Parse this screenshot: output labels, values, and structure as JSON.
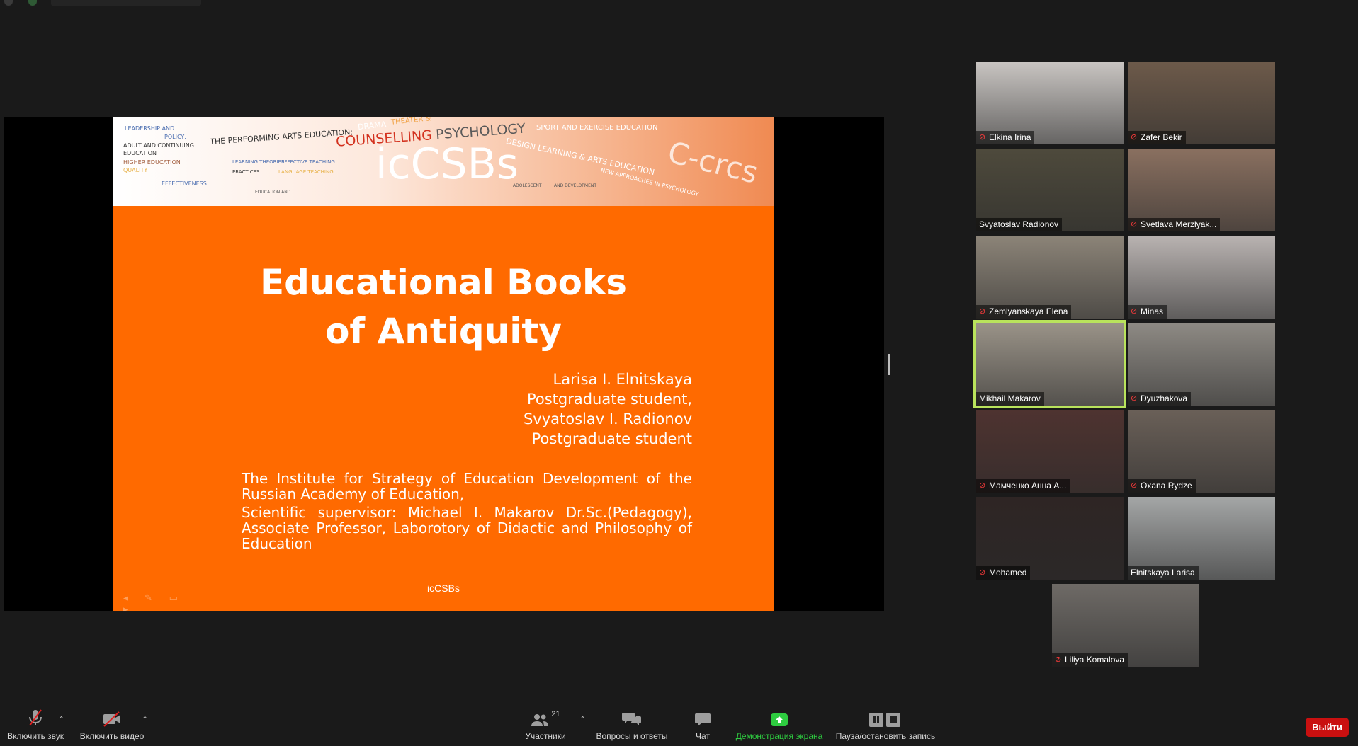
{
  "slide": {
    "title_line1": "Educational Books",
    "title_line2": "of Antiquity",
    "authors": [
      "Larisa I. Elnitskaya",
      "Postgraduate student,",
      "Svyatoslav I. Radionov",
      "Postgraduate student"
    ],
    "institute": "The Institute for Strategy of Education Development of the Russian Academy of Education,",
    "supervisor": "Scientific supervisor: Michael I. Makarov Dr.Sc.(Pedagogy), Associate Professor, Laborotory of Didactic and Philosophy of Education",
    "footer": "icCSBs",
    "banner": {
      "logo": "icCSBs",
      "words": [
        "LEADERSHIP AND",
        "POLICY,",
        "ADULT AND CONTINUING",
        "EDUCATION",
        "HIGHER EDUCATION",
        "QUALITY",
        "EFFECTIVENESS",
        "THE PERFORMING ARTS EDUCATION;",
        "DRAMA",
        "THEATER &",
        "COUNSELLING",
        "PSYCHOLOGY",
        "SPORT AND EXERCISE EDUCATION",
        "LEARNING THEORIES",
        "EFFECTIVE TEACHING",
        "PRACTICES",
        "LANGUAGE TEACHING",
        "EDUCATION AND",
        "DESIGN LEARNING & ARTS EDUCATION",
        "ADOLESCENT",
        "AND DEVELOPMENT",
        "NEW APPROACHES IN PSYCHOLOGY",
        "C-crcs"
      ]
    }
  },
  "participants": [
    {
      "name": "Elkina Irina",
      "muted": true,
      "bg": "#c9c5c2"
    },
    {
      "name": "Zafer Bekir",
      "muted": true,
      "bg": "#6d5a4a"
    },
    {
      "name": "Svyatoslav Radionov",
      "muted": false,
      "bg": "#4e4a3c"
    },
    {
      "name": "Svetlava Merzlyak...",
      "muted": true,
      "bg": "#8a7060"
    },
    {
      "name": "Zemlyanskaya Elena",
      "muted": true,
      "bg": "#8c8478"
    },
    {
      "name": "Minas",
      "muted": true,
      "bg": "#b9b3b1"
    },
    {
      "name": "Mikhail Makarov",
      "muted": false,
      "bg": "#9a9388",
      "active": true
    },
    {
      "name": "Dyuzhakova",
      "muted": true,
      "bg": "#8e8a84"
    },
    {
      "name": "Мамченко Анна А...",
      "muted": true,
      "bg": "#4e3330"
    },
    {
      "name": "Oxana Rydze",
      "muted": true,
      "bg": "#6a6058"
    },
    {
      "name": "Mohamed",
      "muted": true,
      "bg": "#2e2524"
    },
    {
      "name": "Elnitskaya Larisa",
      "muted": false,
      "bg": "#a4a6a6"
    },
    {
      "name": "Liliya Komalova",
      "muted": true,
      "bg": "#6e6a66"
    }
  ],
  "toolbar": {
    "unmute": "Включить звук",
    "start_video": "Включить видео",
    "participants": "Участники",
    "participants_count": "21",
    "qa": "Вопросы и ответы",
    "chat": "Чат",
    "share": "Демонстрация экрана",
    "record": "Пауза/остановить запись",
    "leave": "Выйти"
  },
  "colors": {
    "slide_bg": "#ff6a00",
    "share_label": "#2ecc40",
    "leave_bg": "#c91010",
    "active_speaker": "#b9e35c"
  }
}
